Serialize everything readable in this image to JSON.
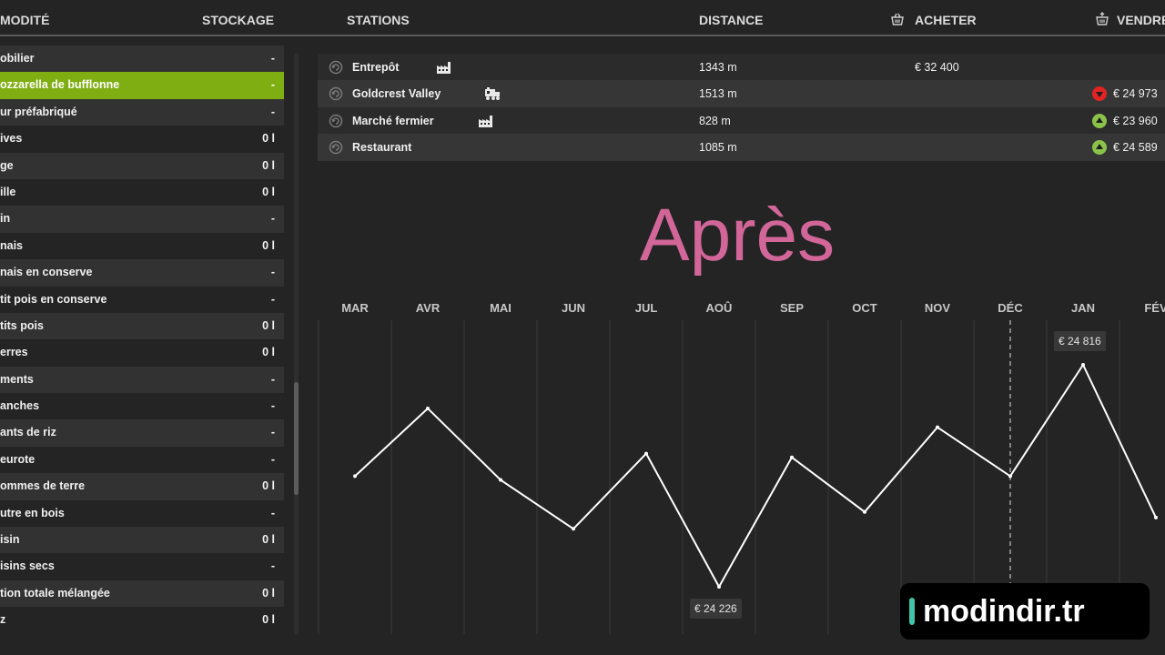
{
  "header": {
    "commodity": "MODITÉ",
    "storage": "STOCKAGE",
    "stations": "STATIONS",
    "distance": "DISTANCE",
    "buy": "ACHETER",
    "sell": "VENDRE"
  },
  "commodities": [
    {
      "name": "obilier",
      "qty": "-"
    },
    {
      "name": "ozzarella de bufflonne",
      "qty": "-",
      "selected": true
    },
    {
      "name": "ur préfabriqué",
      "qty": "-"
    },
    {
      "name": "ives",
      "qty": "0 l"
    },
    {
      "name": "ge",
      "qty": "0 l"
    },
    {
      "name": "ille",
      "qty": "0 l"
    },
    {
      "name": "in",
      "qty": "-"
    },
    {
      "name": "nais",
      "qty": "0 l"
    },
    {
      "name": "nais en conserve",
      "qty": "-"
    },
    {
      "name": "tit pois en conserve",
      "qty": "-"
    },
    {
      "name": "tits pois",
      "qty": "0 l"
    },
    {
      "name": "erres",
      "qty": "0 l"
    },
    {
      "name": "ments",
      "qty": "-"
    },
    {
      "name": "anches",
      "qty": "-"
    },
    {
      "name": "ants de riz",
      "qty": "-"
    },
    {
      "name": "eurote",
      "qty": "-"
    },
    {
      "name": "ommes de terre",
      "qty": "0 l"
    },
    {
      "name": "utre en bois",
      "qty": "-"
    },
    {
      "name": "isin",
      "qty": "0 l"
    },
    {
      "name": "isins secs",
      "qty": "-"
    },
    {
      "name": "tion totale mélangée",
      "qty": "0 l"
    },
    {
      "name": "z",
      "qty": "0 l"
    }
  ],
  "stations": [
    {
      "name": "Entrepôt",
      "distance": "1343 m",
      "buy": "€ 32 400",
      "sell": "",
      "trend": "",
      "type_icon": "factory-icon"
    },
    {
      "name": "Goldcrest Valley",
      "distance": "1513 m",
      "buy": "",
      "sell": "€ 24 973",
      "trend": "down",
      "type_icon": "train-icon"
    },
    {
      "name": "Marché fermier",
      "distance": "828 m",
      "buy": "",
      "sell": "€ 23 960",
      "trend": "up",
      "type_icon": "factory-icon"
    },
    {
      "name": "Restaurant",
      "distance": "1085 m",
      "buy": "",
      "sell": "€ 24 589",
      "trend": "up",
      "type_icon": ""
    }
  ],
  "overlay_title": "Après",
  "chart_data": {
    "type": "line",
    "categories": [
      "MAR",
      "AVR",
      "MAI",
      "JUN",
      "JUL",
      "AOÛ",
      "SEP",
      "OCT",
      "NOV",
      "DÉC",
      "JAN",
      "FÉV"
    ],
    "values": [
      24520,
      24700,
      24510,
      24380,
      24580,
      24226,
      24570,
      24425,
      24650,
      24520,
      24816,
      24410
    ],
    "current_month": "DÉC",
    "annotations": [
      {
        "month": "JAN",
        "label": "€ 24 816",
        "kind": "max"
      },
      {
        "month": "AOÛ",
        "label": "€ 24 226",
        "kind": "min"
      }
    ],
    "ylim": [
      24150,
      24880
    ],
    "line_color": "#ffffff",
    "grid": true
  },
  "colors": {
    "accent": "#7fae12",
    "title": "#d26699",
    "trend_up": "#8bc34a",
    "trend_down": "#e02424"
  },
  "watermark": "modindir.tr"
}
